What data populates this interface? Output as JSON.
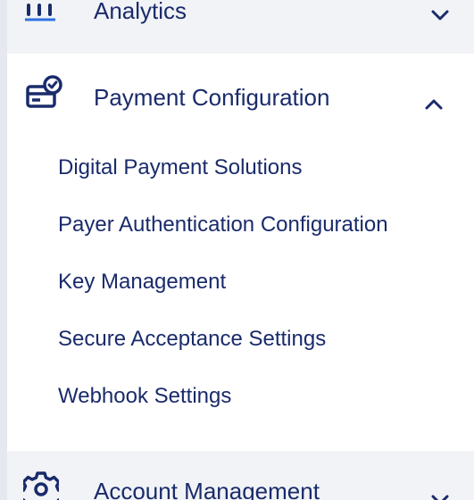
{
  "nav": {
    "analytics": {
      "label": "Analytics",
      "icon": "bar-chart-icon",
      "expanded": false
    },
    "payment_configuration": {
      "label": "Payment Configuration",
      "icon": "card-check-icon",
      "expanded": true,
      "items": [
        {
          "label": "Digital Payment Solutions"
        },
        {
          "label": "Payer Authentication Configuration"
        },
        {
          "label": "Key Management"
        },
        {
          "label": "Secure Acceptance Settings"
        },
        {
          "label": "Webhook Settings"
        }
      ]
    },
    "account_management": {
      "label": "Account Management",
      "icon": "gear-icon",
      "expanded": false
    }
  },
  "colors": {
    "nav_text": "#1a2b6b",
    "collapsed_bg": "#f1f3f6",
    "side_rail": "#e5e8ee"
  }
}
